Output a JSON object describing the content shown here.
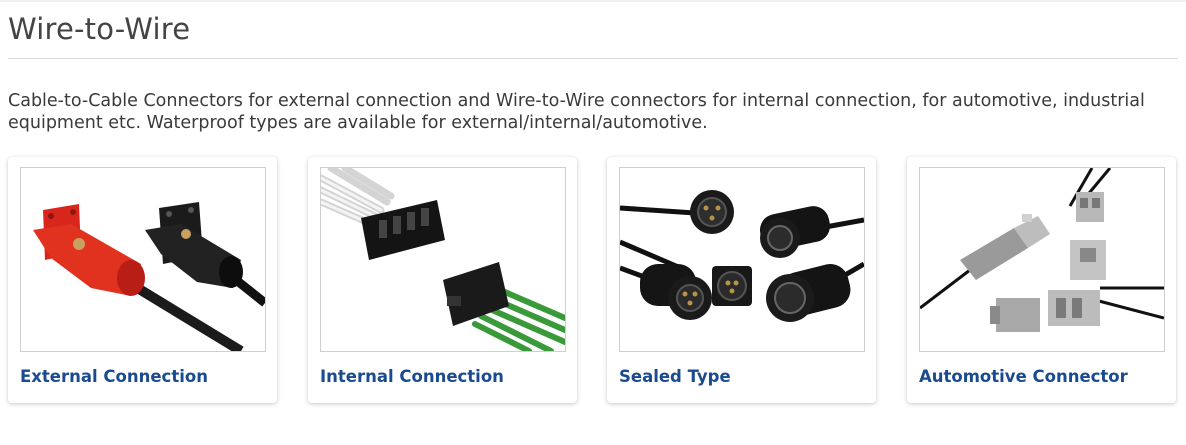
{
  "page": {
    "title": "Wire-to-Wire",
    "description": "Cable-to-Cable Connectors for external connection and Wire-to-Wire connectors for internal connection, for automotive, industrial equipment etc. Waterproof types are available for external/internal/automotive."
  },
  "categories": [
    {
      "label": "External Connection",
      "image": "external-connection-image"
    },
    {
      "label": "Internal Connection",
      "image": "internal-connection-image"
    },
    {
      "label": "Sealed Type",
      "image": "sealed-type-image"
    },
    {
      "label": "Automotive Connector",
      "image": "automotive-connector-image"
    }
  ],
  "colors": {
    "link": "#1a4a8f",
    "title": "#444444",
    "text": "#3a3a3a",
    "connector_red": "#d9261c",
    "connector_black": "#1b1b1b",
    "wire_green": "#3a9a3a",
    "connector_gray": "#a8a8a8"
  }
}
